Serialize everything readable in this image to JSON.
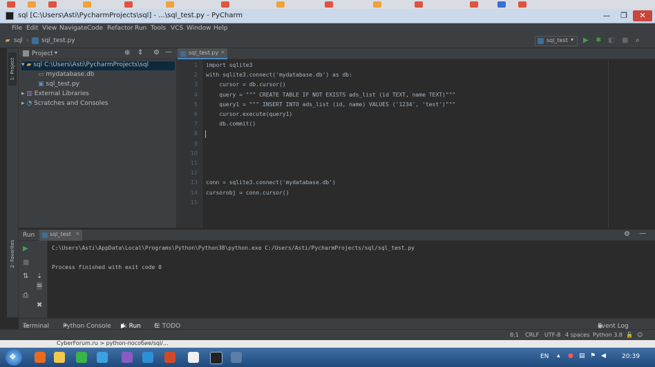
{
  "title_bar": {
    "text": "sql [C:\\Users\\Asti\\PycharmProjects\\sql] - ...\\sql_test.py - PyCharm",
    "minimize": "—",
    "maximize": "❐",
    "close": "✕"
  },
  "menu": [
    "File",
    "Edit",
    "View",
    "Navigate",
    "Code",
    "Refactor",
    "Run",
    "Tools",
    "VCS",
    "Window",
    "Help"
  ],
  "nav": {
    "project": "sql",
    "file": "sql_test.py",
    "run_config": "sql_test"
  },
  "project_panel": {
    "title": "Project",
    "stripe_label": "1: Project",
    "tree": [
      {
        "label": "sql  C:\\Users\\Asti\\PycharmProjects\\sql",
        "level": 0
      },
      {
        "label": "mydatabase.db",
        "level": 1
      },
      {
        "label": "sql_test.py",
        "level": 1
      },
      {
        "label": "External Libraries",
        "level": 0
      },
      {
        "label": "Scratches and Consoles",
        "level": 0
      }
    ]
  },
  "editor": {
    "tab": "sql_test.py",
    "lines": [
      {
        "num": "1",
        "text": "import sqlite3"
      },
      {
        "num": "2",
        "text": "with sqlite3.connect('mydatabase.db') as db:"
      },
      {
        "num": "3",
        "text": "    cursor = db.cursor()"
      },
      {
        "num": "4",
        "text": "    query = \"\"\" CREATE TABLE IF NOT EXISTS ads_list (id TEXT, name TEXT)\"\"\""
      },
      {
        "num": "5",
        "text": "    query1 = \"\"\" INSERT INTO ads_list (id, name) VALUES ('1234', 'test')\"\"\""
      },
      {
        "num": "6",
        "text": "    cursor.execute(query1)"
      },
      {
        "num": "7",
        "text": "    db.commit()"
      },
      {
        "num": "8",
        "text": ""
      },
      {
        "num": "9",
        "text": ""
      },
      {
        "num": "10",
        "text": ""
      },
      {
        "num": "11",
        "text": ""
      },
      {
        "num": "12",
        "text": ""
      },
      {
        "num": "13",
        "text": "conn = sqlite3.connect('mydatabase.db')"
      },
      {
        "num": "14",
        "text": "cursorobj = conn.cursor()"
      },
      {
        "num": "15",
        "text": ""
      }
    ]
  },
  "run_panel": {
    "label": "Run",
    "tab": "sql_test",
    "stripe_label": "2: Favorites",
    "console": [
      "C:\\Users\\Asti\\AppData\\Local\\Programs\\Python\\Python38\\python.exe C:/Users/Asti/PycharmProjects/sql/sql_test.py",
      "Process finished with exit code 0"
    ]
  },
  "tool_tabs": [
    "Terminal",
    "Python Console",
    "4: Run",
    "6: TODO"
  ],
  "event_log": "Event Log",
  "status": {
    "position": "8:1",
    "line_sep": "CRLF",
    "encoding": "UTF-8",
    "indent": "4 spaces",
    "interpreter": "Python 3.8"
  },
  "under_strip": "CyberForum.ru > python-пособие/sql/...",
  "taskbar": {
    "lang": "EN",
    "time": "20:39"
  },
  "colors": {
    "accent": "#499c54",
    "selection": "#0d293e"
  }
}
